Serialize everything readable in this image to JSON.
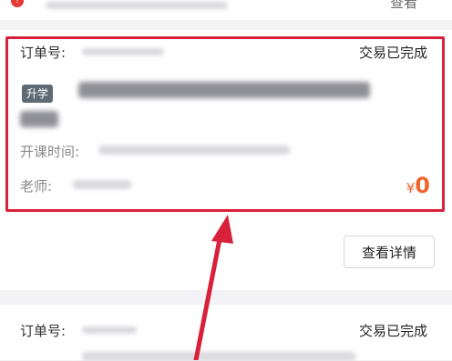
{
  "top": {
    "view_label": "查看"
  },
  "order1": {
    "order_label": "订单号:",
    "status": "交易已完成",
    "tag": "升学",
    "time_label": "开课时间:",
    "teacher_label": "老师:",
    "currency": "¥",
    "price": "0"
  },
  "detail_button": "查看详情",
  "order2": {
    "order_label": "订单号:",
    "status": "交易已完成"
  },
  "colors": {
    "highlight": "#d8213a",
    "price": "#f0642e",
    "tag": "#5f6b74"
  }
}
